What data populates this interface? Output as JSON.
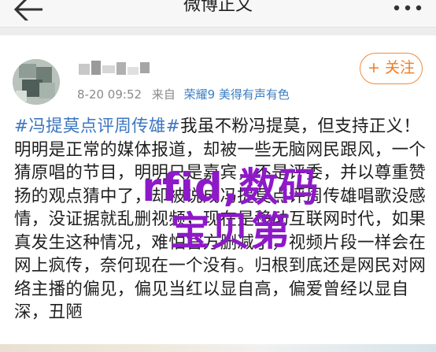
{
  "nav": {
    "title": "微博正文",
    "back_icon": "back-arrow-icon",
    "more_icon": "more-dots-icon"
  },
  "post": {
    "time": "8-20 09:52",
    "source_prefix": "来自",
    "source": "荣耀9 美得有声有色",
    "follow_label": "+ 关注",
    "hashtag": "#冯提莫点评周传雄#",
    "body": "我虽不粉冯提莫，但支持正义！明明是正常的媒体报道，却被一些无脑网民跟风，一个猜原唱的节目，明明只是嘉宾，不是评委，并以尊重赞扬的观点猜中了，却被说成冯提莫点评周传雄唱歌没感情，没证据就乱删视频，现在是移动互联网时代，如果真发生这种情况，难怕官方删减了，视频片段一样会在网上疯传，奈何现在一个没有。归根到底还是网民对网络主播的偏见，偏见当红以显自高，偏爱曾经以显自深，丑陋"
  },
  "watermark": {
    "line1": "rfid,数码",
    "line2": "宝贝第",
    "color": "#8e19c9"
  },
  "colors": {
    "link": "#3b76c0",
    "accent": "#f07b22"
  }
}
